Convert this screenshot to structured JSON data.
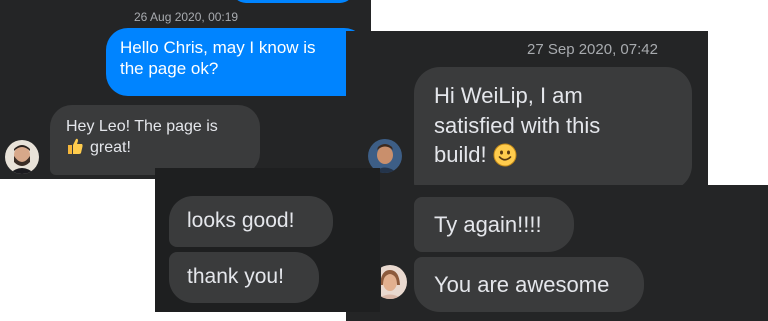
{
  "chat1": {
    "timestamp": "26 Aug 2020, 00:19",
    "outgoing": [
      "Hello Chris, may I know is",
      "the page ok?"
    ],
    "incoming": [
      "Hey Leo! The page is",
      "great!"
    ],
    "incoming_emoji": "thumbs-up-icon"
  },
  "chat2": {
    "messages": [
      "looks good!",
      "thank you!"
    ]
  },
  "chat3": {
    "timestamp": "27 Sep 2020, 07:42",
    "message1": [
      "Hi WeiLip, I am",
      "satisfied with this",
      "build!"
    ],
    "message1_emoji": "smiley-icon",
    "message2": "Ty again!!!!",
    "message3": "You are awesome"
  },
  "colors": {
    "background": "#242526",
    "bubble_incoming": "#3a3b3c",
    "bubble_outgoing": "#0084ff",
    "text": "#e4e6eb",
    "timestamp": "#a8abaf"
  }
}
